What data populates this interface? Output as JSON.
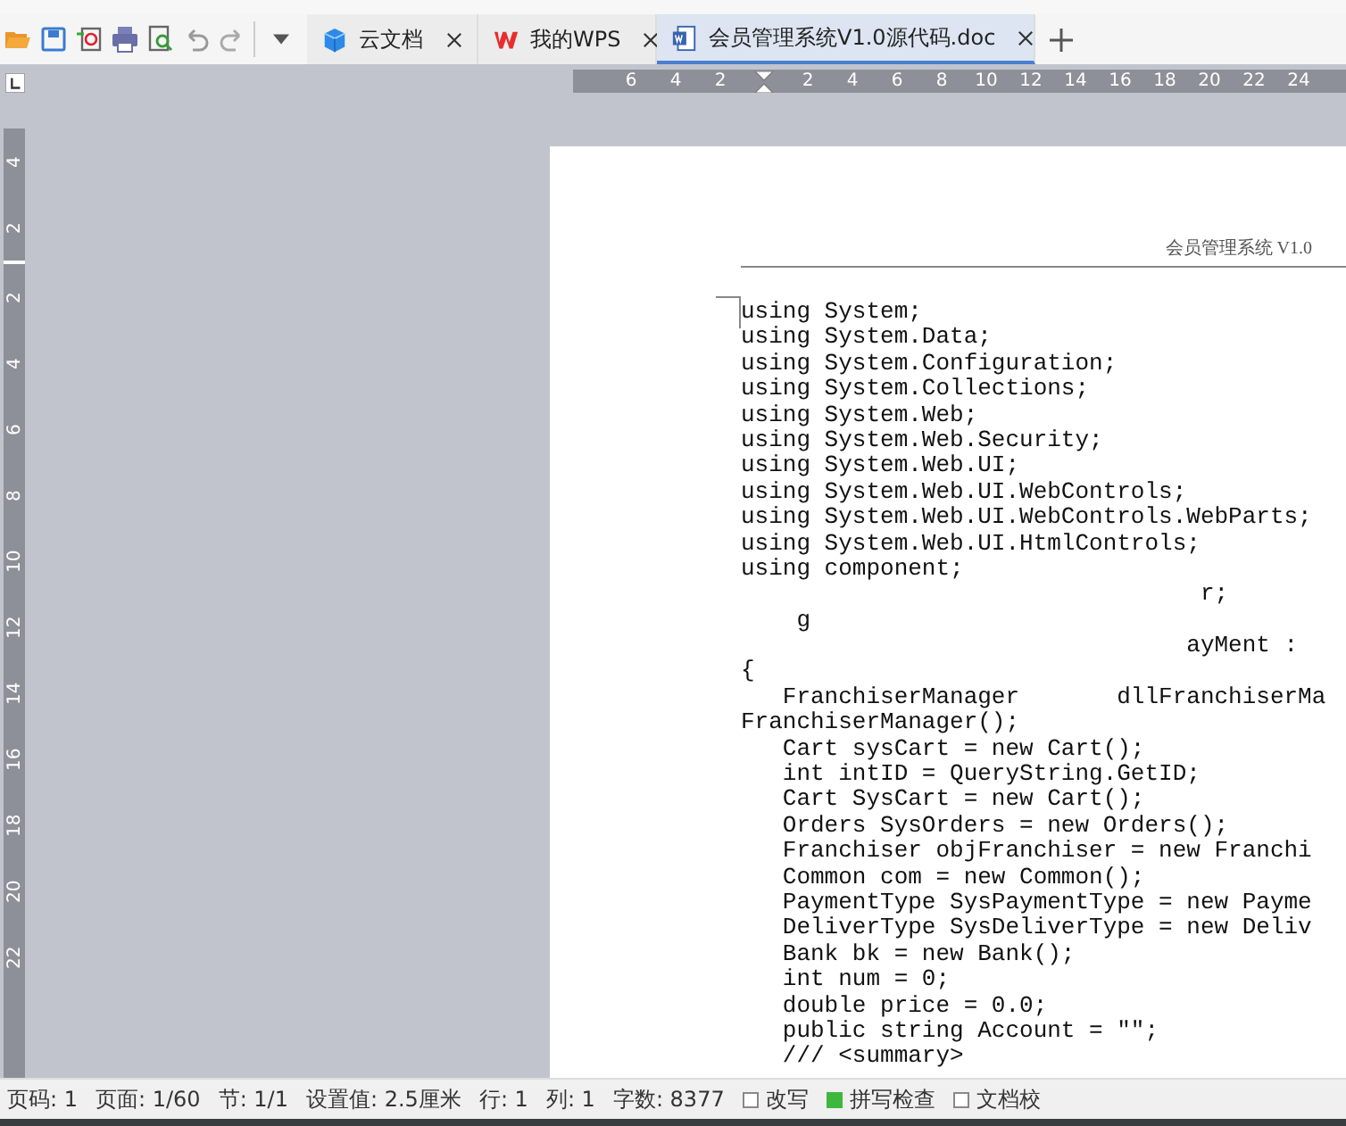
{
  "tabs": [
    {
      "label": "云文档",
      "kind": "cloud",
      "selected": false
    },
    {
      "label": "我的WPS",
      "kind": "wps",
      "selected": false
    },
    {
      "label": "会员管理系统V1.0源代码.doc",
      "kind": "doc",
      "selected": true
    }
  ],
  "ruler": {
    "left_numbers": [
      "6",
      "4",
      "2"
    ],
    "right_numbers": [
      "2",
      "4",
      "6",
      "8",
      "10",
      "12",
      "14",
      "16",
      "18",
      "20",
      "22",
      "24"
    ],
    "top_numbers": [
      "4",
      "2"
    ],
    "bottom_numbers": [
      "2",
      "4",
      "6",
      "8",
      "10",
      "12",
      "14",
      "16",
      "18",
      "20",
      "22"
    ]
  },
  "document": {
    "header": "会员管理系统 V1.0",
    "lines": [
      "using System;",
      "using System.Data;",
      "using System.Configuration;",
      "using System.Collections;",
      "using System.Web;",
      "using System.Web.Security;",
      "using System.Web.UI;",
      "using System.Web.UI.WebControls;",
      "using System.Web.UI.WebControls.WebParts;",
      "using System.Web.UI.HtmlControls;",
      "using component;",
      "                                 r;",
      "    g",
      "                                ayMent :",
      "{",
      "   FranchiserManager       dllFranchiserMa",
      "FranchiserManager();",
      "   Cart sysCart = new Cart();",
      "   int intID = QueryString.GetID;",
      "   Cart SysCart = new Cart();",
      "   Orders SysOrders = new Orders();",
      "   Franchiser objFranchiser = new Franchi",
      "   Common com = new Common();",
      "   PaymentType SysPaymentType = new Payme",
      "   DeliverType SysDeliverType = new Deliv",
      "   Bank bk = new Bank();",
      "   int num = 0;",
      "   double price = 0.0;",
      "   public string Account = \"\";",
      "   /// <summary>"
    ]
  },
  "status_bar": {
    "items": [
      {
        "text": "页码: 1",
        "kind": "text"
      },
      {
        "text": "页面: 1/60",
        "kind": "text"
      },
      {
        "text": "节: 1/1",
        "kind": "text"
      },
      {
        "text": "设置值: 2.5厘米",
        "kind": "text"
      },
      {
        "text": "行: 1",
        "kind": "text"
      },
      {
        "text": "列: 1",
        "kind": "text"
      },
      {
        "text": "字数: 8377",
        "kind": "text"
      },
      {
        "text": "改写",
        "kind": "checkbox",
        "checked": false
      },
      {
        "text": "拼写检查",
        "kind": "checkbox",
        "checked": true
      },
      {
        "text": "文档校",
        "kind": "checkbox",
        "checked": false
      }
    ]
  }
}
